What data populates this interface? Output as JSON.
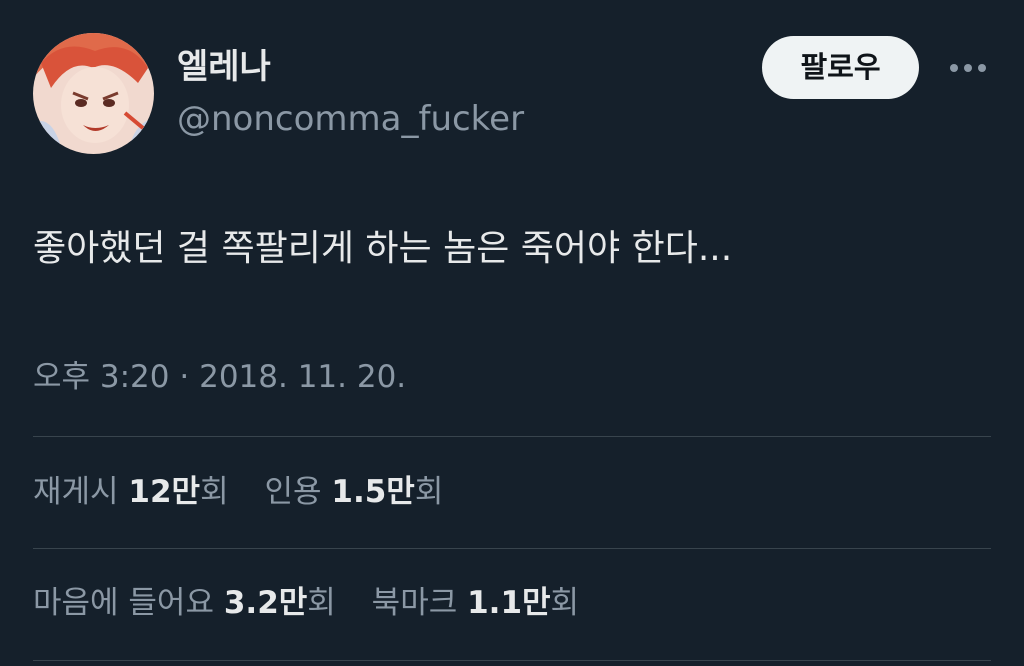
{
  "author": {
    "display_name": "엘레나",
    "handle": "@noncomma_fucker"
  },
  "actions": {
    "follow_label": "팔로우",
    "more_icon": "more-horizontal-icon"
  },
  "tweet": {
    "text": "좋아했던 걸 쪽팔리게 하는 놈은 죽어야 한다...",
    "time": "오후 3:20",
    "separator": "·",
    "date": "2018. 11. 20."
  },
  "stats": {
    "retweets": {
      "label": "재게시",
      "count": "12만",
      "suffix": "회"
    },
    "quotes": {
      "label": "인용",
      "count": "1.5만",
      "suffix": "회"
    },
    "likes": {
      "label": "마음에 들어요",
      "count": "3.2만",
      "suffix": "회"
    },
    "bookmarks": {
      "label": "북마크",
      "count": "1.1만",
      "suffix": "회"
    }
  },
  "colors": {
    "background": "#15202b",
    "primary_text": "#e7e9ea",
    "secondary_text": "#8b98a5",
    "divider": "#38444d",
    "follow_button_bg": "#eff3f4"
  }
}
